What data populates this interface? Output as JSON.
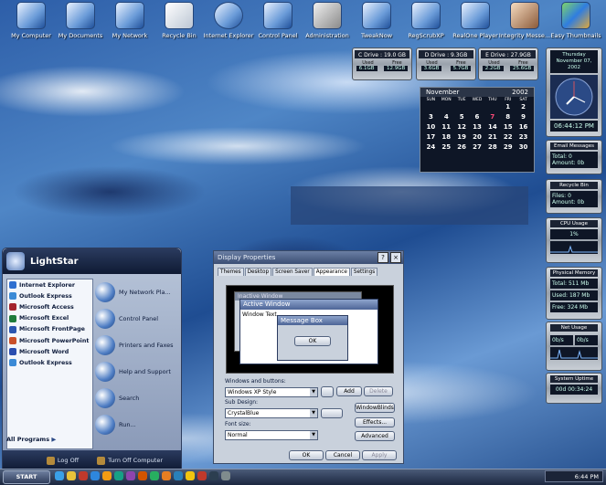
{
  "desktop_icons": [
    {
      "label": "My Computer"
    },
    {
      "label": "My Documents"
    },
    {
      "label": "My Network"
    },
    {
      "label": "Recycle Bin"
    },
    {
      "label": "Internet Explorer"
    },
    {
      "label": "Control Panel"
    },
    {
      "label": "Administration"
    },
    {
      "label": "TweakNow"
    },
    {
      "label": "RegScrubXP"
    },
    {
      "label": "RealOne Player"
    },
    {
      "label": "Integrity Messe..."
    },
    {
      "label": "Easy Thumbnails"
    }
  ],
  "drives": [
    {
      "title": "C Drive : 19.0 GB",
      "used_label": "Used",
      "free_label": "Free",
      "used": "6.1GB",
      "free": "12.9GB"
    },
    {
      "title": "D Drive : 9.3GB",
      "used_label": "Used",
      "free_label": "Free",
      "used": "3.6GB",
      "free": "5.7GB"
    },
    {
      "title": "E Drive : 27.9GB",
      "used_label": "Used",
      "free_label": "Free",
      "used": "2.2GB",
      "free": "25.6GB"
    }
  ],
  "calendar": {
    "month": "November",
    "year": "2002",
    "dows": [
      "SUN",
      "MON",
      "TUE",
      "WED",
      "THU",
      "FRI",
      "SAT"
    ],
    "days": [
      "",
      "",
      "",
      "",
      "",
      "1",
      "2",
      "3",
      "4",
      "5",
      "6",
      "7",
      "8",
      "9",
      "10",
      "11",
      "12",
      "13",
      "14",
      "15",
      "16",
      "17",
      "18",
      "19",
      "20",
      "21",
      "22",
      "23",
      "24",
      "25",
      "26",
      "27",
      "28",
      "29",
      "30"
    ],
    "today": "7"
  },
  "clock": {
    "day": "Thursday",
    "date": "November 07, 2002",
    "time": "06:44:12 PM"
  },
  "widgets": {
    "email": {
      "title": "Email Messages",
      "l1": "Total: 0",
      "l2": "Amount: 0b"
    },
    "recycle": {
      "title": "Recycle Bin",
      "l1": "Files: 0",
      "l2": "Amount: 0b"
    },
    "cpu": {
      "title": "CPU Usage",
      "value": "1%"
    },
    "mem": {
      "title": "Physical Memory",
      "l1": "Total: 511 Mb",
      "l2": "Used: 187 Mb",
      "l3": "Free: 324 Mb"
    },
    "net": {
      "title": "Net Usage",
      "down": "0b/s",
      "up": "0b/s"
    },
    "uptime": {
      "title": "System Uptime",
      "value": "00d 00:34:24"
    }
  },
  "start_menu": {
    "title": "LightStar",
    "programs": [
      {
        "label": "Internet Explorer",
        "color": "#2f6fd0"
      },
      {
        "label": "Outlook Express",
        "color": "#3b8ad6"
      },
      {
        "label": "Microsoft Access",
        "color": "#a4242d"
      },
      {
        "label": "Microsoft Excel",
        "color": "#1f7b3b"
      },
      {
        "label": "Microsoft FrontPage",
        "color": "#2a56b0"
      },
      {
        "label": "Microsoft PowerPoint",
        "color": "#c9502a"
      },
      {
        "label": "Microsoft Word",
        "color": "#2a4eb0"
      },
      {
        "label": "Outlook Express",
        "color": "#3b8ad6"
      }
    ],
    "all_programs": "All Programs",
    "places": [
      {
        "label": "My Network Pla..."
      },
      {
        "label": "Control Panel"
      },
      {
        "label": "Printers and Faxes"
      },
      {
        "label": "Help and Support"
      },
      {
        "label": "Search"
      },
      {
        "label": "Run..."
      }
    ],
    "log_off": "Log Off",
    "turn_off": "Turn Off Computer"
  },
  "dialog": {
    "title": "Display Properties",
    "tabs": [
      "Themes",
      "Desktop",
      "Screen Saver",
      "Appearance",
      "Settings"
    ],
    "active_tab": "Appearance",
    "preview": {
      "inactive": "Inactive Window",
      "active": "Active Window",
      "window_text": "Window Text",
      "message_box": "Message Box",
      "ok": "OK"
    },
    "windows_buttons_label": "Windows and buttons:",
    "windows_buttons_value": "Windows XP Style",
    "add": "Add",
    "delete": "Delete",
    "sub_design_label": "Sub Design:",
    "sub_design_value": "CrystalBlue",
    "windowblinds": "WindowBlinds",
    "effects": "Effects...",
    "font_size_label": "Font size:",
    "font_size_value": "Normal",
    "advanced": "Advanced",
    "ok": "OK",
    "cancel": "Cancel",
    "apply": "Apply"
  },
  "taskbar": {
    "start": "START",
    "quick_colors": [
      "#3aa0e8",
      "#e8c23a",
      "#c0392b",
      "#2e86de",
      "#f39c12",
      "#16a085",
      "#8e44ad",
      "#d35400",
      "#27ae60",
      "#e67e22",
      "#2980b9",
      "#f1c40f",
      "#c0392b",
      "#2c3e50",
      "#7f8c8d"
    ],
    "time": "6:44 PM"
  }
}
